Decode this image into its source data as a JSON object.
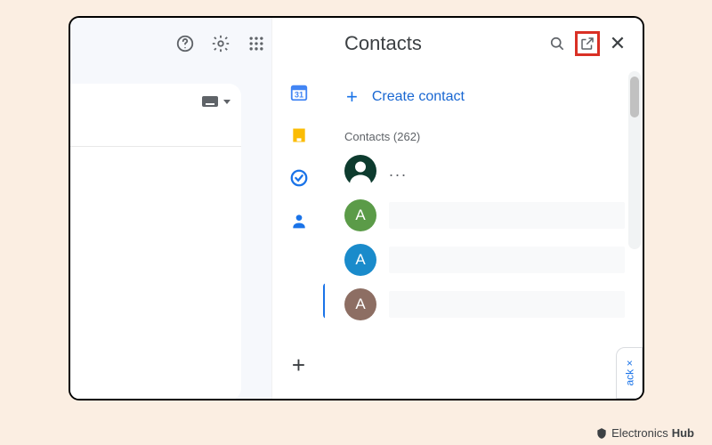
{
  "panel": {
    "title": "Contacts",
    "create_label": "Create contact",
    "section_label": "Contacts (262)"
  },
  "contacts": [
    {
      "initial": "",
      "name": "...",
      "color": "#0d3b2e",
      "svg": true
    },
    {
      "initial": "A",
      "name": "",
      "color": "#5b9b48"
    },
    {
      "initial": "A",
      "name": "",
      "color": "#1a8bcb"
    },
    {
      "initial": "A",
      "name": "",
      "color": "#8d6e63"
    }
  ],
  "rail": {
    "calendar_day": "31"
  },
  "feedback": {
    "label": "ack  ×"
  },
  "footer": {
    "brand_a": "Electronics",
    "brand_b": "Hub"
  }
}
